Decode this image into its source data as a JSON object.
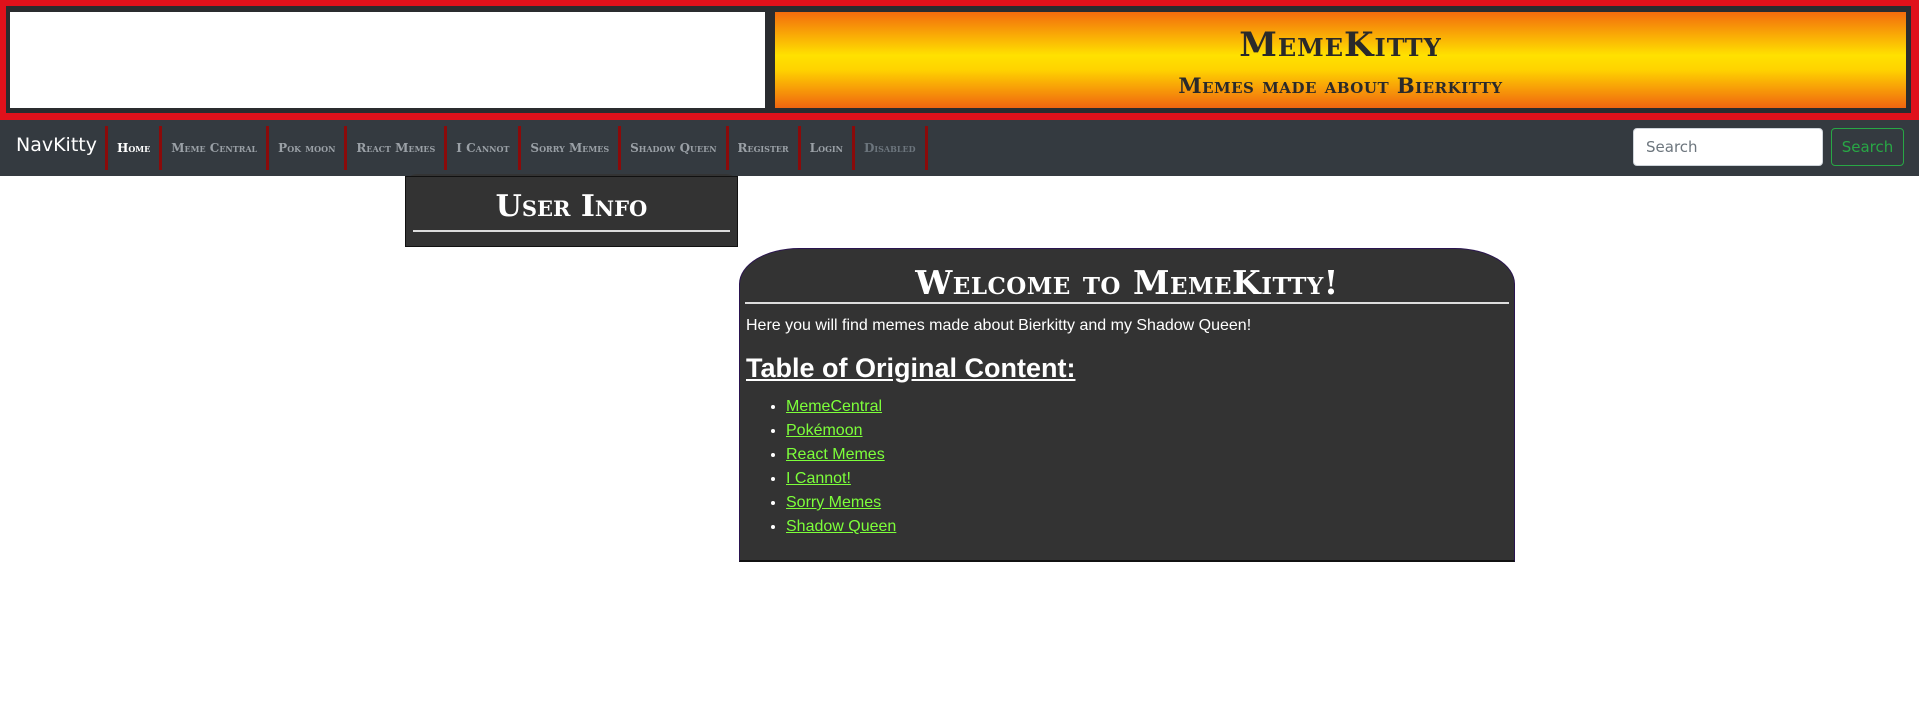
{
  "header": {
    "title": "MemeKitty",
    "subtitle": "Memes made about Bierkitty"
  },
  "navbar": {
    "brand": "NavKitty",
    "items": [
      {
        "label": "Home",
        "state": "active"
      },
      {
        "label": "Meme Central",
        "state": "normal"
      },
      {
        "label": "Pok  moon",
        "state": "normal"
      },
      {
        "label": "React Memes",
        "state": "normal"
      },
      {
        "label": "I Cannot",
        "state": "normal"
      },
      {
        "label": "Sorry Memes",
        "state": "normal"
      },
      {
        "label": "Shadow Queen",
        "state": "normal"
      },
      {
        "label": "Register",
        "state": "normal"
      },
      {
        "label": "Login",
        "state": "normal"
      },
      {
        "label": "Disabled",
        "state": "disabled"
      }
    ],
    "search": {
      "placeholder": "Search",
      "value": "",
      "button_label": "Search"
    }
  },
  "user_info": {
    "title": "User Info"
  },
  "welcome": {
    "title": "Welcome to MemeKitty!",
    "intro": "Here you will find memes made about Bierkitty and my Shadow Queen!",
    "toc_heading": "Table of Original Content:",
    "toc_links": [
      "MemeCentral",
      "Pokémoon",
      "React Memes",
      "I Cannot!",
      "Sorry Memes",
      "Shadow Queen"
    ]
  },
  "colors": {
    "header_border": "#e0111b",
    "nav_bg": "#343a40",
    "nav_divider": "#8b0a0a",
    "panel_bg": "#333333",
    "link": "#7dff3a",
    "search_button": "#28a745"
  }
}
